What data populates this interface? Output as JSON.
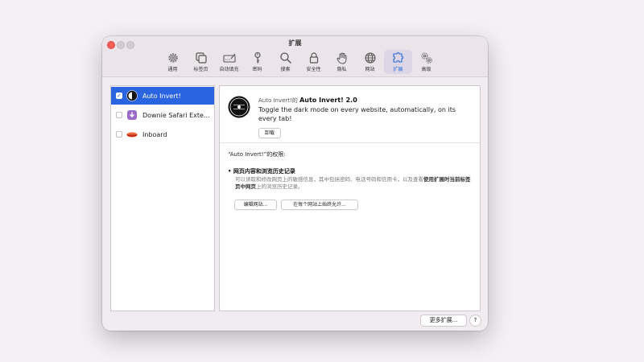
{
  "window": {
    "title": "扩展"
  },
  "toolbar": {
    "items": [
      {
        "label": "通用",
        "icon": "gear-icon"
      },
      {
        "label": "标签页",
        "icon": "tabs-icon"
      },
      {
        "label": "自动填充",
        "icon": "autofill-icon"
      },
      {
        "label": "密码",
        "icon": "key-icon"
      },
      {
        "label": "搜索",
        "icon": "magnifier-icon"
      },
      {
        "label": "安全性",
        "icon": "lock-icon"
      },
      {
        "label": "隐私",
        "icon": "hand-icon"
      },
      {
        "label": "网站",
        "icon": "globe-icon"
      },
      {
        "label": "扩展",
        "icon": "puzzle-icon",
        "active": true
      },
      {
        "label": "高级",
        "icon": "advanced-gears-icon"
      }
    ]
  },
  "extensions": [
    {
      "name": "Auto Invert!",
      "checked": true,
      "selected": true,
      "icon": "auto-invert-logo"
    },
    {
      "name": "Downie Safari Exte...",
      "checked": false,
      "selected": false,
      "icon": "downie-icon"
    },
    {
      "name": "Inboard",
      "checked": false,
      "selected": false,
      "icon": "inboard-icon"
    }
  ],
  "details": {
    "head_prefix": "Auto Invert!的 ",
    "head_name": "Auto Invert! 2.0",
    "description": "Toggle the dark mode on every website, automatically, on its every tab!",
    "uninstall_label": "卸载",
    "permissions_title": "“Auto Invert!”的权限:",
    "permission_item": "• 网页内容和浏览历史记录",
    "permission_desc_part1": "可以读取和修改网页上的敏感信息，其中包括密码、电话号码和信用卡，以及查看",
    "permission_desc_bold": "使用扩展时当前标签页中网页",
    "permission_desc_part2": "上的浏览历史记录。",
    "edit_sites_label": "编辑网站...",
    "allow_all_label": "在每个网站上始终允许..."
  },
  "footer": {
    "more_label": "更多扩展...",
    "help_label": "?"
  },
  "colors": {
    "accent": "#2b64e0",
    "close": "#ff5f57"
  }
}
